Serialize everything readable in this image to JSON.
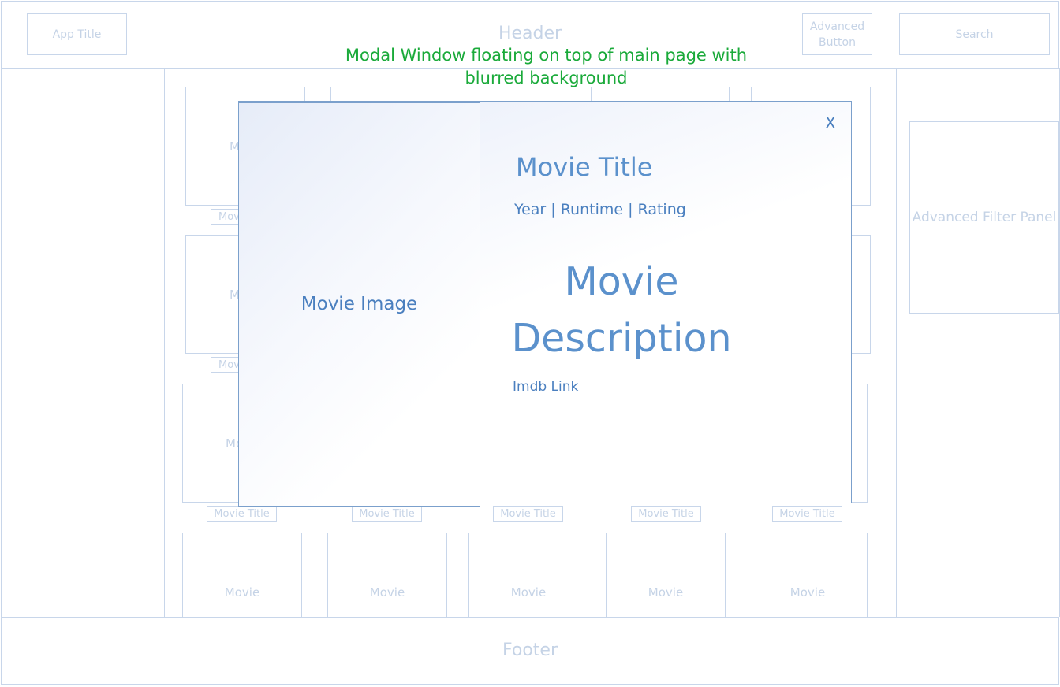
{
  "header": {
    "title": "Header",
    "app_title": "App Title",
    "advanced_button": "Advanced Button",
    "search": "Search"
  },
  "annotation": {
    "text": "Modal Window floating on top of main page with blurred background"
  },
  "sidebar_right": {
    "advanced_filter_panel": "Advanced Filter Panel"
  },
  "grid": {
    "partial_movie_label": "Mo",
    "partial_title_label": "Movi",
    "movie_title_label": "Movie Title",
    "movie_label": "Movie"
  },
  "modal": {
    "image_label": "Movie Image",
    "close": "X",
    "title": "Movie Title",
    "meta": "Year | Runtime | Rating",
    "description": "Movie Description",
    "imdb_link": "Imdb Link"
  },
  "footer": {
    "title": "Footer"
  },
  "colors": {
    "faded": "#c5d3e6",
    "modal_accent": "#5b91cc",
    "annotation": "#1aaa3a"
  }
}
